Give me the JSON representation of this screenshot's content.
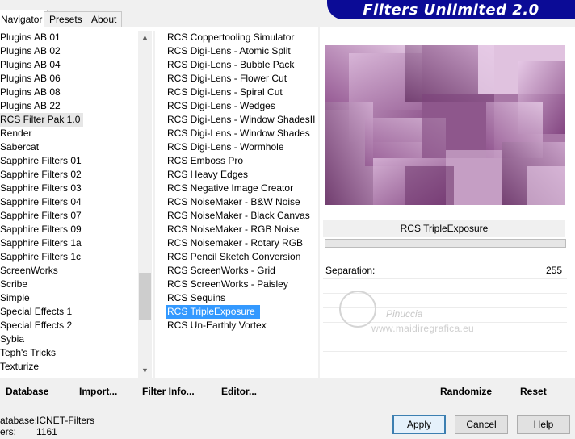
{
  "tabs": [
    "Navigator",
    "Presets",
    "About"
  ],
  "banner": "Filters Unlimited 2.0",
  "categories": [
    "Plugins AB 01",
    "Plugins AB 02",
    "Plugins AB 04",
    "Plugins AB 06",
    "Plugins AB 08",
    "Plugins AB 22",
    "RCS Filter Pak 1.0",
    "Render",
    "Sabercat",
    "Sapphire Filters 01",
    "Sapphire Filters 02",
    "Sapphire Filters 03",
    "Sapphire Filters 04",
    "Sapphire Filters 07",
    "Sapphire Filters 09",
    "Sapphire Filters 1a",
    "Sapphire Filters 1c",
    "ScreenWorks",
    "Scribe",
    "Simple",
    "Special Effects 1",
    "Special Effects 2",
    "Sybia",
    "Teph's Tricks",
    "Texturize"
  ],
  "selected_category": "RCS Filter Pak 1.0",
  "filters": [
    "RCS Coppertooling Simulator",
    "RCS Digi-Lens - Atomic Split",
    "RCS Digi-Lens - Bubble Pack",
    "RCS Digi-Lens - Flower Cut",
    "RCS Digi-Lens - Spiral Cut",
    "RCS Digi-Lens - Wedges",
    "RCS Digi-Lens - Window ShadesII",
    "RCS Digi-Lens - Window Shades",
    "RCS Digi-Lens - Wormhole",
    "RCS Emboss Pro",
    "RCS Heavy Edges",
    "RCS Negative Image Creator",
    "RCS NoiseMaker - B&W Noise",
    "RCS NoiseMaker - Black Canvas",
    "RCS NoiseMaker - RGB Noise",
    "RCS Noisemaker - Rotary RGB",
    "RCS Pencil Sketch Conversion",
    "RCS ScreenWorks - Grid",
    "RCS ScreenWorks - Paisley",
    "RCS Sequins",
    "RCS TripleExposure",
    "RCS Un-Earthly Vortex"
  ],
  "selected_filter": "RCS TripleExposure",
  "preview": {
    "filter_name": "RCS TripleExposure"
  },
  "param": {
    "label": "Separation:",
    "value": "255"
  },
  "watermark": {
    "name": "Pinuccia",
    "url": "www.maidiregrafica.eu"
  },
  "bottom_buttons": {
    "database": "Database",
    "import": "Import...",
    "filter_info": "Filter Info...",
    "editor": "Editor...",
    "randomize": "Randomize",
    "reset": "Reset"
  },
  "info": {
    "database_label": "atabase:",
    "database_value": "ICNET-Filters",
    "filters_label": "ers:",
    "filters_value": "1161"
  },
  "dialog": {
    "apply": "Apply",
    "cancel": "Cancel",
    "help": "Help"
  },
  "colors": {
    "selection": "#3399ff",
    "banner": "#0b0b96",
    "preview_base": "#b88fb8"
  }
}
